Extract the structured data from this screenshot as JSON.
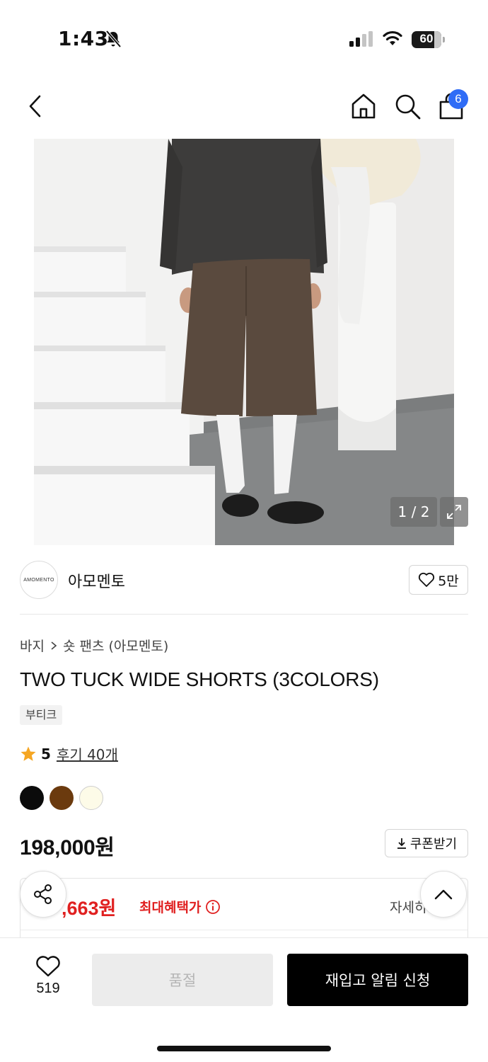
{
  "status_bar": {
    "time": "1:43",
    "battery": "60",
    "battery_level": 0.6,
    "icons": [
      "bell-off-icon",
      "signal-icon",
      "wifi-icon",
      "battery-icon"
    ]
  },
  "nav": {
    "cart_count": "6",
    "icons": [
      "back-arrow-icon",
      "home-icon",
      "search-icon",
      "shopping-bag-icon"
    ]
  },
  "gallery": {
    "counter": "1 / 2"
  },
  "brand": {
    "logo_text": "AMOMENTO",
    "name": "아모멘토",
    "likes": "5만"
  },
  "product": {
    "breadcrumb": [
      "바지",
      "숏 팬츠 (아모멘토)"
    ],
    "title": "TWO TUCK WIDE SHORTS (3COLORS)",
    "tag": "부티크",
    "rating": "5",
    "reviews": "후기 40개",
    "swatches": [
      "#0b0b0b",
      "#6b3a0e",
      "#fdfbe8"
    ],
    "price": "198,000원",
    "coupon_label": "쿠폰받기"
  },
  "benefit": {
    "price": ",663원",
    "label": "최대혜택가",
    "detail": "자세히"
  },
  "bottom_bar": {
    "wish_count": "519",
    "soldout_label": "품절",
    "restock_label": "재입고 알림 신청"
  },
  "colors": {
    "accent_blue": "#2f6cf6",
    "benefit_red": "#e02020",
    "star": "#f5a623"
  }
}
